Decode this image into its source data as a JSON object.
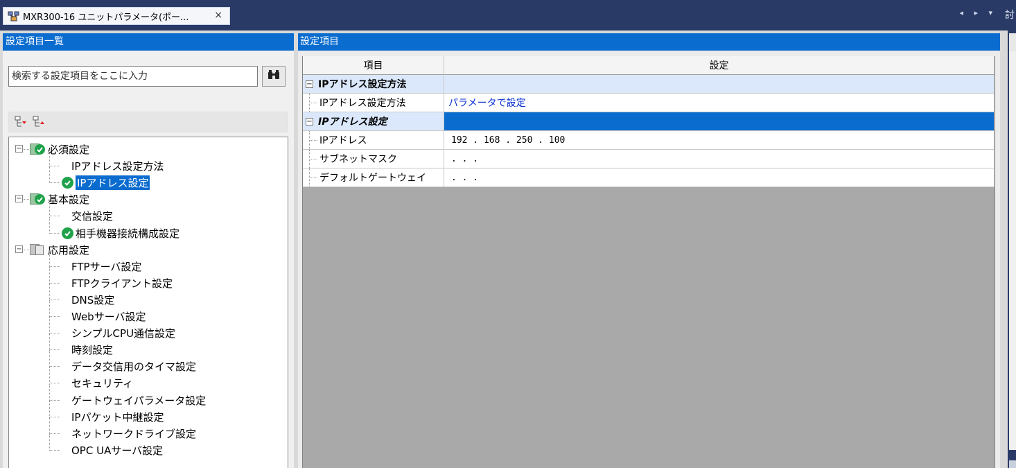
{
  "tab": {
    "title": "MXR300-16 ユニットパラメータ(ポー...",
    "close": "×"
  },
  "tabstrip": {
    "nav": "◂ ▸ ▾",
    "edge_glyph": "討"
  },
  "left_panel": {
    "title": "設定項目一覧",
    "search_placeholder": "検索する設定項目をここに入力"
  },
  "tree": [
    {
      "label": "必須設定",
      "level": 0,
      "icon": "folder-check-icon",
      "expander": "−"
    },
    {
      "label": "IPアドレス設定方法",
      "level": 1,
      "icon": "none"
    },
    {
      "label": "IPアドレス設定",
      "level": 1,
      "icon": "check-icon",
      "selected": true
    },
    {
      "label": "基本設定",
      "level": 0,
      "icon": "folder-check-icon",
      "expander": "−"
    },
    {
      "label": "交信設定",
      "level": 1,
      "icon": "none"
    },
    {
      "label": "相手機器接続構成設定",
      "level": 1,
      "icon": "check-icon"
    },
    {
      "label": "応用設定",
      "level": 0,
      "icon": "folder-doc-icon",
      "expander": "−"
    },
    {
      "label": "FTPサーバ設定",
      "level": 1,
      "icon": "none"
    },
    {
      "label": "FTPクライアント設定",
      "level": 1,
      "icon": "none"
    },
    {
      "label": "DNS設定",
      "level": 1,
      "icon": "none"
    },
    {
      "label": "Webサーバ設定",
      "level": 1,
      "icon": "none"
    },
    {
      "label": "シンプルCPU通信設定",
      "level": 1,
      "icon": "none"
    },
    {
      "label": "時刻設定",
      "level": 1,
      "icon": "none"
    },
    {
      "label": "データ交信用のタイマ設定",
      "level": 1,
      "icon": "none"
    },
    {
      "label": "セキュリティ",
      "level": 1,
      "icon": "none"
    },
    {
      "label": "ゲートウェイパラメータ設定",
      "level": 1,
      "icon": "none"
    },
    {
      "label": "IPパケット中継設定",
      "level": 1,
      "icon": "none"
    },
    {
      "label": "ネットワークドライブ設定",
      "level": 1,
      "icon": "none"
    },
    {
      "label": "OPC UAサーバ設定",
      "level": 1,
      "icon": "none"
    }
  ],
  "right_panel": {
    "title": "設定項目",
    "columns": [
      "項目",
      "設定"
    ],
    "rows": [
      {
        "type": "category",
        "label": "IPアドレス設定方法",
        "value": "",
        "expander": "−"
      },
      {
        "type": "item",
        "label": "IPアドレス設定方法",
        "value": "パラメータで設定",
        "value_style": "blue"
      },
      {
        "type": "category-selected",
        "label": "IPアドレス設定",
        "value": "",
        "expander": "−"
      },
      {
        "type": "item",
        "label": "IPアドレス",
        "value": "192 . 168 . 250 . 100"
      },
      {
        "type": "item",
        "label": "サブネットマスク",
        "value": ". . ."
      },
      {
        "type": "item",
        "label": "デフォルトゲートウェイ",
        "value": ". . ."
      }
    ]
  },
  "colors": {
    "accent": "#0a6ccf",
    "check": "#1fa24b",
    "value_link": "#0a2fd6",
    "grid_bg": "#a9a9a9"
  }
}
